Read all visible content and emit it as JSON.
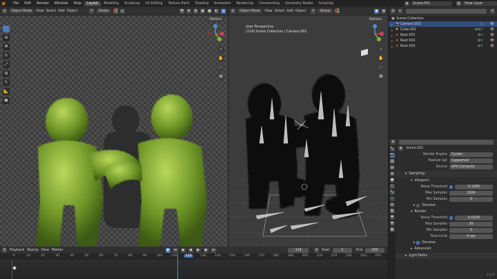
{
  "menu": {
    "items": [
      "File",
      "Edit",
      "Render",
      "Window",
      "Help"
    ],
    "workspaces": [
      "Layout",
      "Modeling",
      "Sculpting",
      "UV Editing",
      "Texture Paint",
      "Shading",
      "Animation",
      "Rendering",
      "Compositing",
      "Geometry Nodes",
      "Scripting"
    ],
    "scene": "Scene.001",
    "view_layer": "View Layer"
  },
  "vp1": {
    "mode": "Object Mode",
    "menus": [
      "View",
      "Select",
      "Add",
      "Object"
    ],
    "orientation": "Global",
    "options": "Options"
  },
  "vp2": {
    "mode": "Object Mode",
    "menus": [
      "View",
      "Select",
      "Add",
      "Object"
    ],
    "orientation": "Global",
    "options": "Options",
    "overlay_title": "User Perspective",
    "overlay_sub": "(114) Scene Collection | Camera.003"
  },
  "outliner": {
    "root": "Scene Collection",
    "rows": [
      {
        "name": "Camera.003",
        "icon": "camera-icon"
      },
      {
        "name": "Cube.001",
        "icon": "mesh-icon"
      },
      {
        "name": "Root.001",
        "icon": "armature-icon"
      },
      {
        "name": "Root.002",
        "icon": "armature-icon"
      },
      {
        "name": "Root.003",
        "icon": "armature-icon"
      }
    ]
  },
  "props": {
    "scene": "Scene.001",
    "render_engine_label": "Render Engine",
    "render_engine": "Cycles",
    "feature_set_label": "Feature Set",
    "feature_set": "Supported",
    "device_label": "Device",
    "device": "GPU Compute",
    "sampling": "Sampling",
    "viewport": "Viewport",
    "noise_threshold_label": "Noise Threshold",
    "vp_noise": "0.1000",
    "max_samples_label": "Max Samples",
    "vp_max": "1024",
    "min_samples_label": "Min Samples",
    "vp_min": "0",
    "denoise": "Denoise",
    "render": "Render",
    "r_noise": "0.0100",
    "r_max": "20",
    "r_min": "0",
    "time_limit_label": "Time Limit",
    "r_time": "0 sec",
    "advanced": "Advanced",
    "light_paths": "Light Paths"
  },
  "timeline": {
    "menus": [
      "Playback",
      "Keying",
      "View",
      "Marker"
    ],
    "current": "114",
    "start_label": "Start",
    "start": "1",
    "end_label": "End",
    "end": "250",
    "ticks": [
      "0",
      "10",
      "20",
      "30",
      "40",
      "50",
      "60",
      "70",
      "80",
      "90",
      "100",
      "110",
      "114",
      "130",
      "140",
      "150",
      "160",
      "170",
      "180",
      "190",
      "200",
      "210",
      "220",
      "230",
      "240",
      "250"
    ]
  },
  "version": "3.2.0"
}
